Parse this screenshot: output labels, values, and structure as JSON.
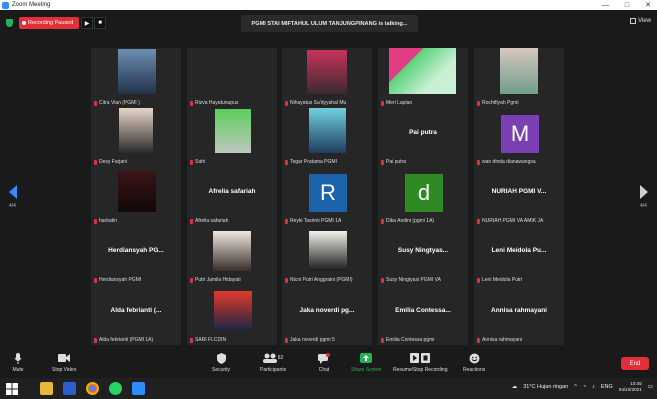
{
  "window": {
    "title": "Zoom Meeting",
    "minimize": "—",
    "maximize": "□",
    "close": "✕"
  },
  "topbar": {
    "recording_label": "Recording Paused",
    "play_glyph": "▶",
    "stop_glyph": "■",
    "meeting_title": "PGMI STAI MIFTAHUL ULUM TANJUNGPINANG is talking...",
    "view_label": "View"
  },
  "pagination": {
    "left": "4/4",
    "right": "4/4"
  },
  "tiles": [
    {
      "name": "Citra Vian (PGMI )",
      "big": "",
      "avatar": "",
      "avatar_color": ""
    },
    {
      "name": "Rizva Hayatunupus",
      "big": "",
      "avatar": "",
      "avatar_color": ""
    },
    {
      "name": "Nihayatus Sa'dyyahal Mu",
      "big": "",
      "avatar": "",
      "avatar_color": ""
    },
    {
      "name": "Meri Laplan",
      "big": "",
      "avatar": "",
      "avatar_color": ""
    },
    {
      "name": "Rochtfiyah PgmI",
      "big": "",
      "avatar": "",
      "avatar_color": ""
    },
    {
      "name": "Desy Farjani",
      "big": "",
      "avatar": "",
      "avatar_color": ""
    },
    {
      "name": "Safri",
      "big": "",
      "avatar": "",
      "avatar_color": ""
    },
    {
      "name": "Tegar Pratama PGMI",
      "big": "",
      "avatar": "",
      "avatar_color": ""
    },
    {
      "name": "Pai putra",
      "big": "Pai putra",
      "avatar": "",
      "avatar_color": ""
    },
    {
      "name": "wan dinda dianawangsa",
      "big": "",
      "avatar": "M",
      "avatar_color": "#7a3fb3"
    },
    {
      "name": "harbatin",
      "big": "",
      "avatar": "",
      "avatar_color": ""
    },
    {
      "name": "Afrelia safariah",
      "big": "Afrelia safariah",
      "avatar": "",
      "avatar_color": ""
    },
    {
      "name": "Reyki Tasrimi PGMI 1A",
      "big": "",
      "avatar": "R",
      "avatar_color": "#1b63ab"
    },
    {
      "name": "Dika Andini (pgmi 1A)",
      "big": "",
      "avatar": "d",
      "avatar_color": "#2e8a23"
    },
    {
      "name": "NURIAH PGMI VA AMIK JA",
      "big": "NURIAH PGMI V...",
      "avatar": "",
      "avatar_color": ""
    },
    {
      "name": "Herdiansyah PGMI",
      "big": "Herdiansyah PG...",
      "avatar": "",
      "avatar_color": ""
    },
    {
      "name": "Putri Jamila Hidayati",
      "big": "",
      "avatar": "",
      "avatar_color": ""
    },
    {
      "name": "Nicni Putri Anggraini (PGMI)",
      "big": "",
      "avatar": "",
      "avatar_color": ""
    },
    {
      "name": "Susy Ningtyasi PGMI VA",
      "big": "Susy Ningtyas...",
      "avatar": "",
      "avatar_color": ""
    },
    {
      "name": "Leni Meidola Putri",
      "big": "Leni Meidola Pu...",
      "avatar": "",
      "avatar_color": ""
    },
    {
      "name": "Alda febrianti (PGMI 1A)",
      "big": "Alda febrianti (...",
      "avatar": "",
      "avatar_color": ""
    },
    {
      "name": "SARI FLCDIN",
      "big": "",
      "avatar": "",
      "avatar_color": ""
    },
    {
      "name": "Jaka noverdi pgmi 5",
      "big": "Jaka noverdi pg...",
      "avatar": "",
      "avatar_color": ""
    },
    {
      "name": "Emilia Contessa pgmi",
      "big": "Emilia Contessa...",
      "avatar": "",
      "avatar_color": ""
    },
    {
      "name": "Annisa rahmayani",
      "big": "Annisa rahmayani",
      "avatar": "",
      "avatar_color": ""
    }
  ],
  "toolbar": {
    "mute": "Mute",
    "stop_video": "Stop Video",
    "security": "Security",
    "participants": "Participants",
    "participants_count": "82",
    "chat": "Chat",
    "share_screen": "Share Screen",
    "recording": "Resume/Stop Recording",
    "reactions": "Reactions",
    "end": "End"
  },
  "taskbar": {
    "weather": "31°C  Hujan ringan",
    "lang": "ENG",
    "time": "10:45",
    "date": "04/10/2021"
  }
}
